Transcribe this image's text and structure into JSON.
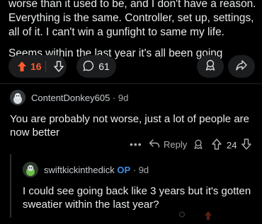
{
  "post": {
    "body_line1": "worse than it used to be, and I don't have a reason. Everything is the same. Controller, set up, settings, all of it. I can't win a gunfight to same my life.",
    "body_line2": "Seems within the last year it's all been going downhill"
  },
  "post_actions": {
    "upvote_count": "16",
    "comment_count": "61",
    "accent_color": "#ff5a2c"
  },
  "comments": [
    {
      "author": "ContentDonkey605",
      "separator": " · ",
      "age": "9d",
      "text": "You are probably not worse, just a lot of people are now better",
      "more": "•••",
      "reply_label": "Reply",
      "score": "24"
    },
    {
      "author": "swiftkickinthedick",
      "op_tag": "OP",
      "separator": " · ",
      "age": "9d",
      "text": "I could see going back like 3 years but it's gotten sweatier within the last year?"
    }
  ],
  "icons": {
    "upvote": "upvote-arrow-icon",
    "downvote": "downvote-arrow-icon",
    "comment": "comment-bubble-icon",
    "award": "award-icon",
    "share": "share-icon",
    "reply": "reply-arrow-icon"
  }
}
